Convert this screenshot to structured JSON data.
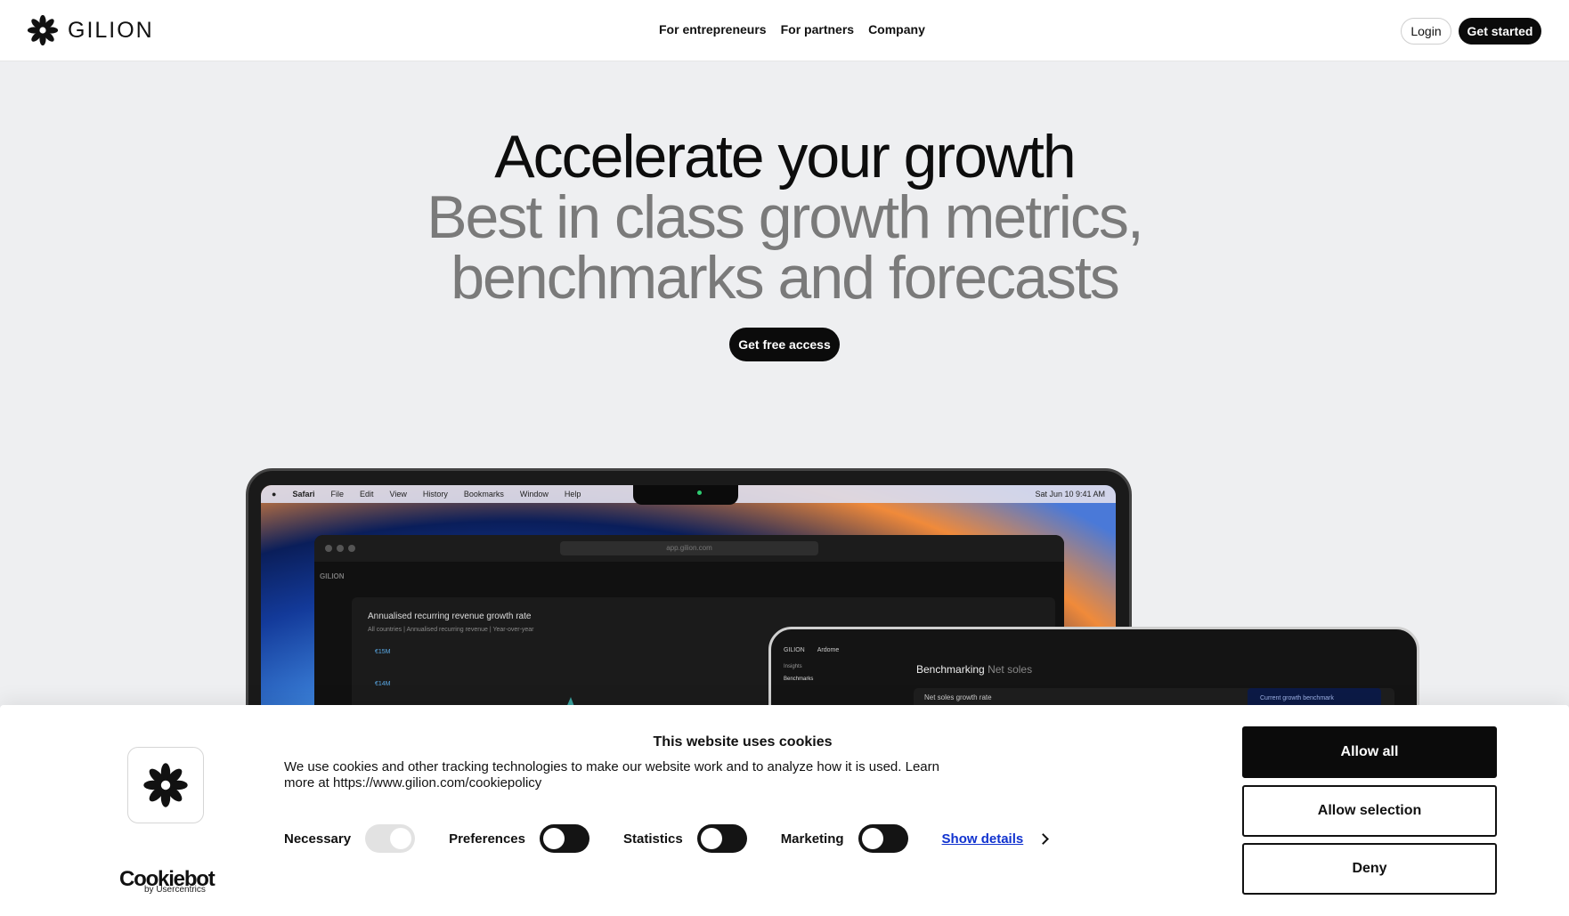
{
  "header": {
    "brand": "GILION",
    "nav": [
      "For entrepreneurs",
      "For partners",
      "Company"
    ],
    "login_label": "Login",
    "get_started_label": "Get started"
  },
  "hero": {
    "line1": "Accelerate your growth",
    "line2": "Best in class growth metrics,",
    "line3": "benchmarks and forecasts",
    "cta_label": "Get free access"
  },
  "laptop": {
    "menubar": [
      "Safari",
      "File",
      "Edit",
      "View",
      "History",
      "Bookmarks",
      "Window",
      "Help"
    ],
    "menubar_clock": "Sat Jun 10  9:41 AM",
    "url": "app.gilion.com",
    "app_brand": "GILION",
    "chart_title": "Annualised recurring revenue growth rate",
    "chart_subtitle": "All countries  |  Annualised recurring revenue  |  Year-over-year",
    "tick_1": "€15M",
    "tick_2": "€14M"
  },
  "tablet": {
    "brand": "GILION",
    "workspace": "Ardome",
    "side_items": [
      "Insights",
      "Benchmarks"
    ],
    "heading_main": "Benchmarking",
    "heading_muted": "Net soles",
    "panel_label": "Net soles growth rate",
    "bench_label": "Current growth benchmark"
  },
  "cookie": {
    "title": "This website uses cookies",
    "text": "We use cookies and other tracking technologies to make our website work and to analyze how it is used. Learn more at https://www.gilion.com/cookiepolicy",
    "toggles": [
      {
        "label": "Necessary",
        "state": "disabled-on"
      },
      {
        "label": "Preferences",
        "state": "off"
      },
      {
        "label": "Statistics",
        "state": "off"
      },
      {
        "label": "Marketing",
        "state": "off"
      }
    ],
    "show_details": "Show details",
    "allow_all": "Allow all",
    "allow_selection": "Allow selection",
    "deny": "Deny",
    "cookiebot_word": "Cookiebot",
    "cookiebot_by": "by Usercentrics"
  },
  "colors": {
    "brand_black": "#0b0b0b",
    "link_blue": "#1032cf",
    "hero_muted": "#7a7a7a",
    "chart_teal": "#3fb7b4"
  }
}
